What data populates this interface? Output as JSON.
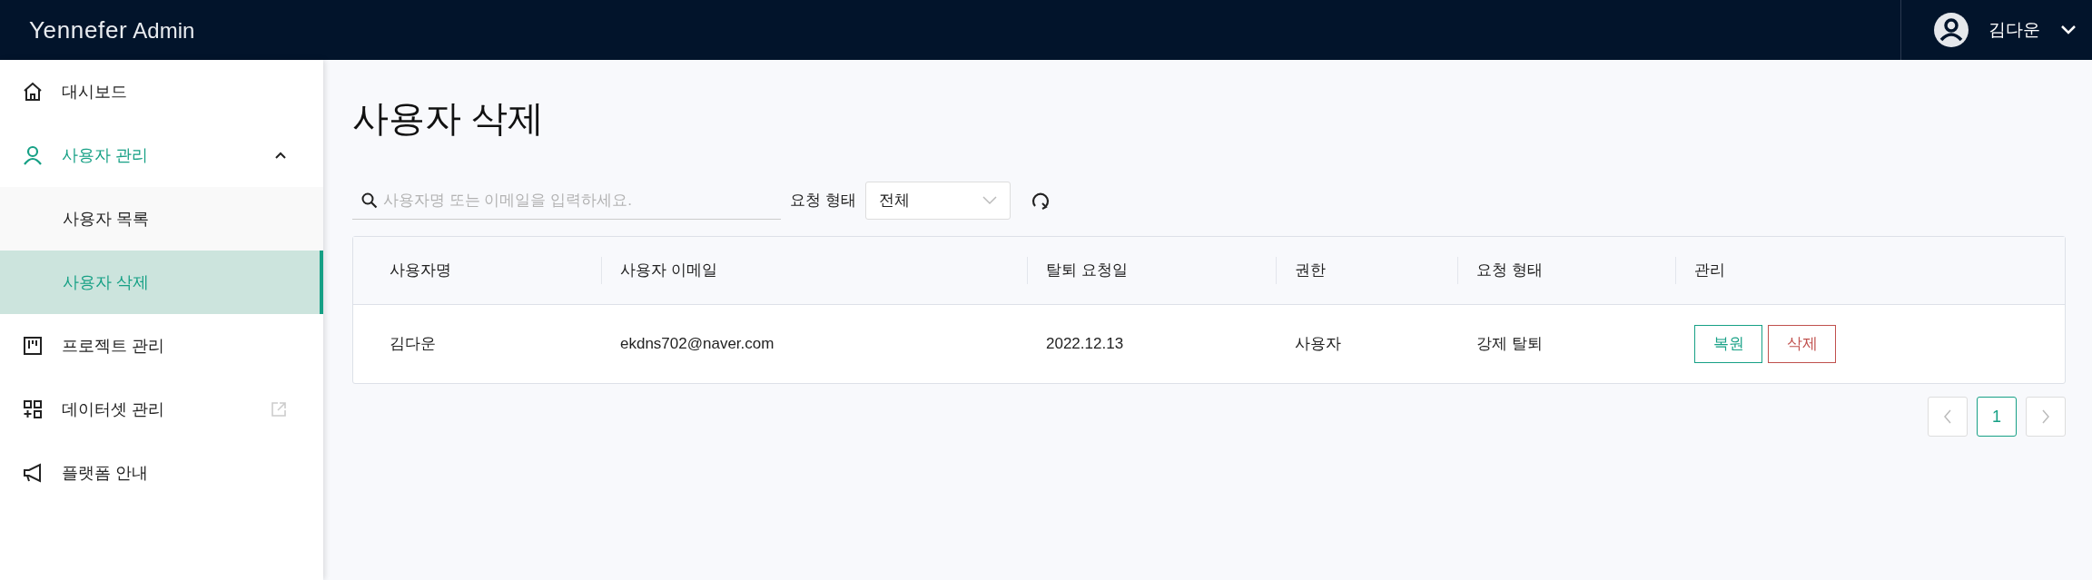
{
  "header": {
    "logo": "Yennefer",
    "logo_suffix": "Admin",
    "user_name": "김다운"
  },
  "sidebar": {
    "items": [
      {
        "kind": "home",
        "label": "대시보드",
        "selected": false
      },
      {
        "kind": "user",
        "label": "사용자 관리",
        "selected": true,
        "expanded": true,
        "children": [
          {
            "label": "사용자 목록",
            "selected": false
          },
          {
            "label": "사용자 삭제",
            "selected": true
          }
        ]
      },
      {
        "kind": "board",
        "label": "프로젝트 관리",
        "selected": false
      },
      {
        "kind": "dataset",
        "label": "데이터셋 관리",
        "selected": false,
        "external": true
      },
      {
        "kind": "megaphone",
        "label": "플랫폼 안내",
        "selected": false
      }
    ]
  },
  "page_title": "사용자 삭제",
  "search": {
    "placeholder": "사용자명 또는 이메일을 입력하세요."
  },
  "filter": {
    "label": "요청 형태",
    "value": "전체"
  },
  "table": {
    "columns": [
      "사용자명",
      "사용자 이메일",
      "탈퇴 요청일",
      "권한",
      "요청 형태",
      "관리"
    ],
    "rows": [
      {
        "cells": [
          "김다운",
          "ekdns702@naver.com",
          "2022.12.13",
          "사용자",
          "강제 탈퇴"
        ],
        "actions": [
          {
            "kind": "restore",
            "label": "복원"
          },
          {
            "kind": "delete",
            "label": "삭제"
          }
        ]
      }
    ]
  },
  "pagination": {
    "pages": [
      {
        "label": "1",
        "selected": true
      }
    ]
  }
}
